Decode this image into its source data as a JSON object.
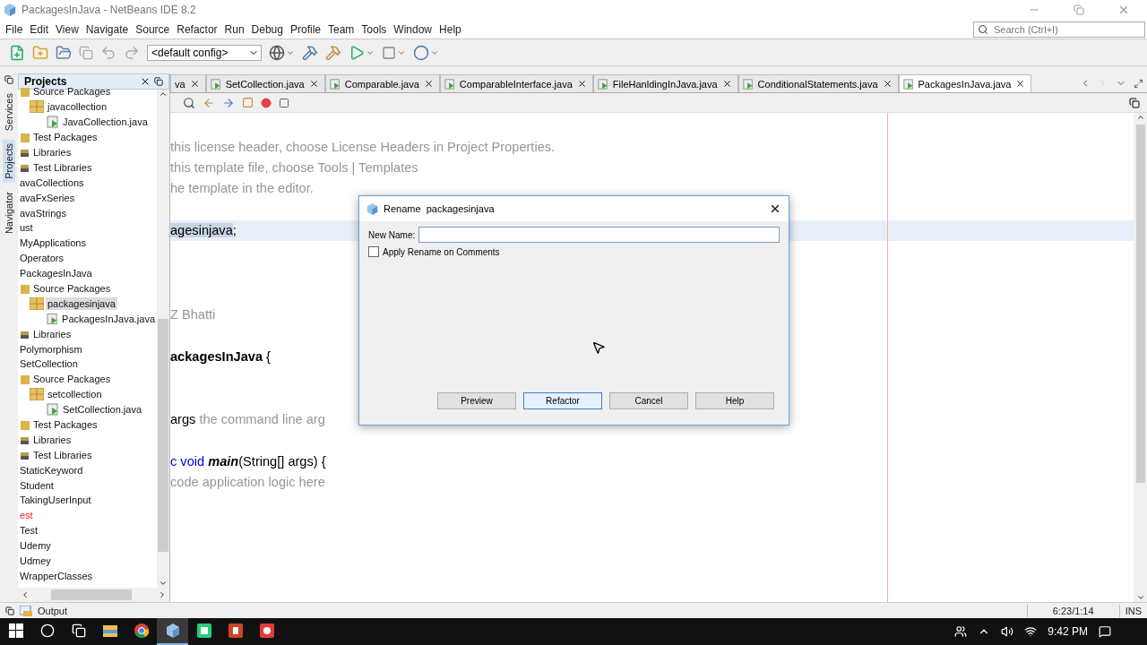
{
  "window": {
    "title": "PackagesInJava - NetBeans IDE 8.2"
  },
  "menu": [
    "File",
    "Edit",
    "View",
    "Navigate",
    "Source",
    "Refactor",
    "Run",
    "Debug",
    "Profile",
    "Team",
    "Tools",
    "Window",
    "Help"
  ],
  "search": {
    "placeholder": "Search (Ctrl+I)"
  },
  "toolbar": {
    "config": "<default config>"
  },
  "side_tabs": [
    {
      "label": "Services",
      "selected": false
    },
    {
      "label": "Projects",
      "selected": true
    },
    {
      "label": "Navigator",
      "selected": false
    }
  ],
  "projects_panel": {
    "title": "Projects",
    "scrolled_children": [
      {
        "label": "Source Packages",
        "kind": "folder",
        "selected": false,
        "children": [
          {
            "label": "javacollection",
            "kind": "package",
            "selected": false,
            "children": [
              {
                "label": "JavaCollection.java",
                "kind": "file",
                "selected": false
              }
            ]
          }
        ]
      },
      {
        "label": "Test Packages",
        "kind": "folder",
        "selected": false
      },
      {
        "label": "Libraries",
        "kind": "library",
        "selected": false
      },
      {
        "label": "Test Libraries",
        "kind": "library",
        "selected": false
      }
    ],
    "tree": [
      {
        "label": "avaCollections",
        "selected": false,
        "error": false
      },
      {
        "label": "avaFxSeries",
        "selected": false,
        "error": false
      },
      {
        "label": "avaStrings",
        "selected": false,
        "error": false
      },
      {
        "label": "ust",
        "selected": false,
        "error": false
      },
      {
        "label": "MyApplications",
        "selected": false,
        "error": false
      },
      {
        "label": "Operators",
        "selected": false,
        "error": false
      },
      {
        "label": "PackagesInJava",
        "selected": false,
        "error": false,
        "children": [
          {
            "label": "Source Packages",
            "kind": "folder",
            "selected": false,
            "children": [
              {
                "label": "packagesinjava",
                "kind": "package",
                "selected": true,
                "children": [
                  {
                    "label": "PackagesInJava.java",
                    "kind": "file",
                    "selected": false
                  }
                ]
              }
            ]
          },
          {
            "label": "Libraries",
            "kind": "library",
            "selected": false
          }
        ]
      },
      {
        "label": "Polymorphism",
        "selected": false,
        "error": false
      },
      {
        "label": "SetCollection",
        "selected": false,
        "error": false,
        "children": [
          {
            "label": "Source Packages",
            "kind": "folder",
            "selected": false,
            "children": [
              {
                "label": "setcollection",
                "kind": "package",
                "selected": false,
                "children": [
                  {
                    "label": "SetCollection.java",
                    "kind": "file",
                    "selected": false
                  }
                ]
              }
            ]
          },
          {
            "label": "Test Packages",
            "kind": "folder",
            "selected": false
          },
          {
            "label": "Libraries",
            "kind": "library",
            "selected": false
          },
          {
            "label": "Test Libraries",
            "kind": "library",
            "selected": false
          }
        ]
      },
      {
        "label": "StaticKeyword",
        "selected": false,
        "error": false
      },
      {
        "label": "Student",
        "selected": false,
        "error": false
      },
      {
        "label": "TakingUserInput",
        "selected": false,
        "error": false
      },
      {
        "label": "est",
        "selected": false,
        "error": true
      },
      {
        "label": "Test",
        "selected": false,
        "error": false
      },
      {
        "label": "Udemy",
        "selected": false,
        "error": false
      },
      {
        "label": "Udmey",
        "selected": false,
        "error": false
      },
      {
        "label": "WrapperClasses",
        "selected": false,
        "error": false
      }
    ]
  },
  "editor_tabs": [
    {
      "label": "va",
      "selected": false
    },
    {
      "label": "SetCollection.java",
      "selected": false
    },
    {
      "label": "Comparable.java",
      "selected": false
    },
    {
      "label": "ComparableInterface.java",
      "selected": false
    },
    {
      "label": "FileHanldingInJava.java",
      "selected": false
    },
    {
      "label": "ConditionalStatements.java",
      "selected": false
    },
    {
      "label": "PackagesInJava.java",
      "selected": true
    }
  ],
  "code_lines": [
    {
      "kind": "code",
      "highlighted": false,
      "segments": [
        {
          "kind": "comment",
          "text": "this license header, choose License Headers in Project Properties."
        }
      ]
    },
    {
      "kind": "code",
      "highlighted": false,
      "segments": [
        {
          "kind": "comment",
          "text": "this template file, choose Tools | Templates"
        }
      ]
    },
    {
      "kind": "code",
      "highlighted": false,
      "segments": [
        {
          "kind": "comment",
          "text": "he template in the editor."
        }
      ]
    },
    {
      "kind": "blank",
      "highlighted": false
    },
    {
      "kind": "code",
      "highlighted": true,
      "segments": [
        {
          "kind": "selection",
          "text": "agesinjava"
        },
        {
          "kind": "plain",
          "text": ";"
        }
      ]
    },
    {
      "kind": "blank",
      "highlighted": false
    },
    {
      "kind": "blank",
      "highlighted": false
    },
    {
      "kind": "blank",
      "highlighted": false
    },
    {
      "kind": "code",
      "highlighted": false,
      "segments": [
        {
          "kind": "comment",
          "text": "Z Bhatti"
        }
      ]
    },
    {
      "kind": "blank",
      "highlighted": false
    },
    {
      "kind": "code",
      "highlighted": false,
      "segments": [
        {
          "kind": "bold",
          "text": "ackagesInJava"
        },
        {
          "kind": "plain",
          "text": " {"
        }
      ]
    },
    {
      "kind": "blank",
      "highlighted": false
    },
    {
      "kind": "blank",
      "highlighted": false
    },
    {
      "kind": "code",
      "highlighted": false,
      "segments": [
        {
          "kind": "plain",
          "text": "args"
        },
        {
          "kind": "comment",
          "text": " the command line arg"
        }
      ]
    },
    {
      "kind": "blank",
      "highlighted": false
    },
    {
      "kind": "code",
      "highlighted": false,
      "segments": [
        {
          "kind": "keyword",
          "text": "c void "
        },
        {
          "kind": "method",
          "text": "main"
        },
        {
          "kind": "plain",
          "text": "(String[] args) {"
        }
      ]
    },
    {
      "kind": "code",
      "highlighted": false,
      "segments": [
        {
          "kind": "comment",
          "text": "code application logic here"
        }
      ]
    }
  ],
  "dialog": {
    "title": "Rename  packagesinjava",
    "field_label": "New Name:",
    "focused": true,
    "checkbox": {
      "label": "Apply Rename on Comments",
      "checked": false
    },
    "buttons": [
      {
        "label": "Preview",
        "default": false
      },
      {
        "label": "Refactor",
        "default": true
      },
      {
        "label": "Cancel",
        "default": false
      },
      {
        "label": "Help",
        "default": false
      }
    ]
  },
  "status_bar": {
    "output_tab": "Output",
    "position": "6:23/1:14",
    "mode": "INS"
  },
  "taskbar": {
    "apps": [
      {
        "kind": "explorer",
        "active": false
      },
      {
        "kind": "chrome",
        "active": false
      },
      {
        "kind": "netbeans",
        "active": true
      },
      {
        "kind": "green",
        "active": false
      },
      {
        "kind": "powerpoint",
        "active": false
      },
      {
        "kind": "red",
        "active": false
      }
    ],
    "time": "9:42 PM"
  }
}
